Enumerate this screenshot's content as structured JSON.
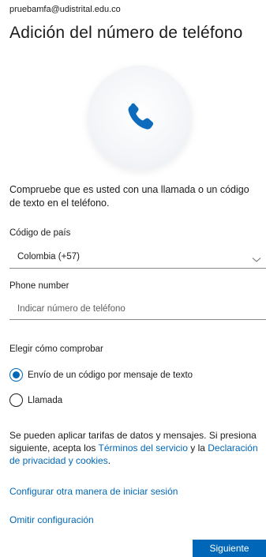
{
  "account_email": "pruebamfa@udistrital.edu.co",
  "page_title": "Adición del número de teléfono",
  "hero_icon": "phone-icon",
  "description": "Compruebe que es usted con una llamada o un código de texto en el teléfono.",
  "country": {
    "label": "Código de país",
    "selected": "Colombia (+57)"
  },
  "phone": {
    "label": "Phone number",
    "placeholder": "Indicar número de teléfono",
    "value": ""
  },
  "verify": {
    "label": "Elegir cómo comprobar",
    "options": [
      {
        "label": "Envío de un código por mensaje de texto",
        "checked": true
      },
      {
        "label": "Llamada",
        "checked": false
      }
    ]
  },
  "terms": {
    "prefix": "Se pueden aplicar tarifas de datos y mensajes. Si presiona siguiente, acepta los ",
    "terms_link": "Términos del servicio",
    "middle": " y la ",
    "privacy_link": "Declaración de privacidad y cookies",
    "suffix": "."
  },
  "links": {
    "other_method": "Configurar otra manera de iniciar sesión",
    "skip": "Omitir configuración"
  },
  "next_button": "Siguiente",
  "colors": {
    "accent": "#0067b8",
    "phone_icon": "#0f6cbd"
  }
}
